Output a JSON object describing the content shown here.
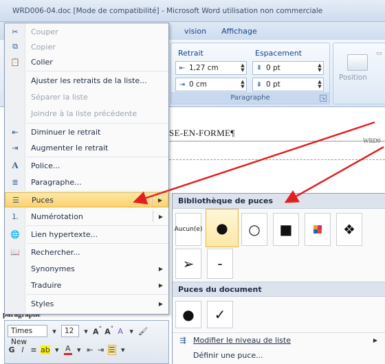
{
  "window": {
    "title": "WRD006-04.doc [Mode de compatibilité] - Microsoft Word utilisation non commerciale"
  },
  "ribbon": {
    "tabs": [
      "vision",
      "Affichage"
    ],
    "paragraph_group": {
      "caption": "Paragraphe",
      "retrait_label": "Retrait",
      "espacement_label": "Espacement",
      "retrait_left": "1,27 cm",
      "retrait_right": "0 cm",
      "espacement_before": "0 pt",
      "espacement_after": "0 pt"
    },
    "position_label": "Position"
  },
  "document": {
    "heading": "SE-EN-FORME¶",
    "heading_right": "WRD0",
    "paragraph_text": "paragraphe"
  },
  "context_menu": {
    "items": [
      {
        "label": "Couper",
        "enabled": false
      },
      {
        "label": "Copier",
        "enabled": false
      },
      {
        "label": "Coller",
        "enabled": true
      },
      {
        "label": "Ajuster les retraits de la liste...",
        "enabled": true
      },
      {
        "label": "Séparer la liste",
        "enabled": false
      },
      {
        "label": "Joindre à la liste précédente",
        "enabled": false
      },
      {
        "label": "Diminuer le retrait",
        "enabled": true
      },
      {
        "label": "Augmenter le retrait",
        "enabled": true
      },
      {
        "label": "Police...",
        "enabled": true
      },
      {
        "label": "Paragraphe...",
        "enabled": true
      },
      {
        "label": "Puces",
        "enabled": true,
        "highlighted": true
      },
      {
        "label": "Numérotation",
        "enabled": true
      },
      {
        "label": "Lien hypertexte...",
        "enabled": true
      },
      {
        "label": "Rechercher...",
        "enabled": true
      },
      {
        "label": "Synonymes",
        "enabled": true
      },
      {
        "label": "Traduire",
        "enabled": true
      },
      {
        "label": "Styles",
        "enabled": true
      }
    ]
  },
  "mini_toolbar": {
    "font": "Times New",
    "size": "12"
  },
  "bullets_menu": {
    "library_title": "Bibliothèque de puces",
    "none_label": "Aucun(e)",
    "library": [
      "●",
      "○",
      "■",
      "",
      "❖",
      "➢",
      "-"
    ],
    "document_title": "Puces du document",
    "document_bullets": [
      "●",
      "✓"
    ],
    "modify_level": "Modifier le niveau de liste",
    "define_new": "Définir une puce..."
  },
  "colors": {
    "highlight": "#fbd26d",
    "arrow": "#e02020"
  }
}
